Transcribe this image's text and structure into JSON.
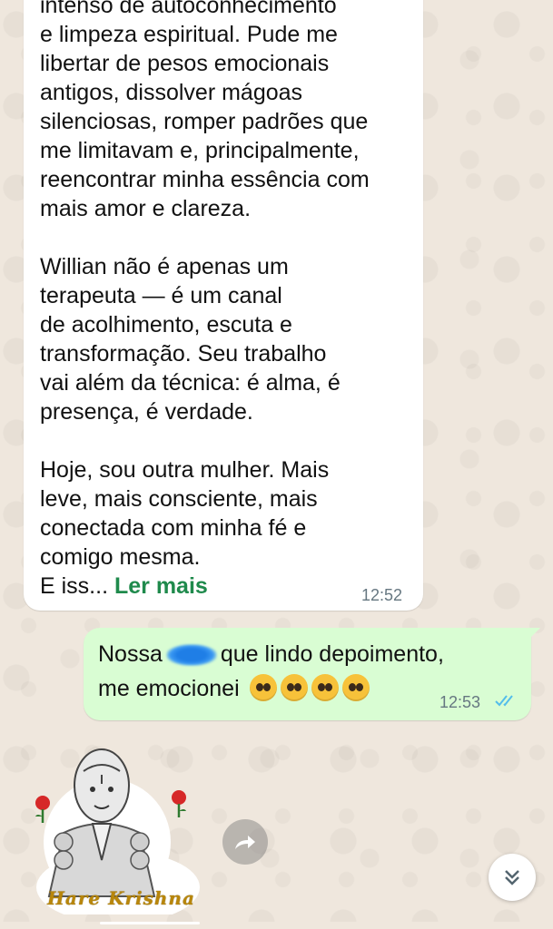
{
  "incoming_message": {
    "lines": [
      "intenso de autoconhecimento",
      "e limpeza espiritual. Pude me",
      "libertar de pesos emocionais",
      "antigos, dissolver mágoas",
      "silenciosas, romper padrões que",
      "me limitavam e, principalmente,",
      "reencontrar minha essência com",
      "mais amor e clareza.",
      "",
      "Willian não é apenas um",
      "terapeuta — é um canal",
      "de acolhimento, escuta e",
      "transformação. Seu trabalho",
      "vai além da técnica: é alma, é",
      "presença, é verdade.",
      "",
      "Hoje, sou outra mulher. Mais",
      "leve, mais consciente, mais",
      "conectada com minha fé e",
      "comigo mesma."
    ],
    "truncated_text": "E iss...",
    "read_more_label": "Ler mais",
    "time": "12:52"
  },
  "outgoing_message": {
    "line1_before": "Nossa",
    "line1_after": "que lindo depoimento,",
    "line2": "me emocionei",
    "emoji_count": 4,
    "emoji": "pleading-face",
    "time": "12:53",
    "status": "read",
    "status_color": "#53bdeb"
  },
  "sticker": {
    "caption": "Hare Krishna"
  },
  "colors": {
    "background": "#efe7dd",
    "incoming_bubble": "#ffffff",
    "outgoing_bubble": "#d9fdd3",
    "link": "#1f8a4c"
  },
  "icons": {
    "forward": "forward-icon",
    "scroll_down": "double-chevron-down-icon"
  }
}
